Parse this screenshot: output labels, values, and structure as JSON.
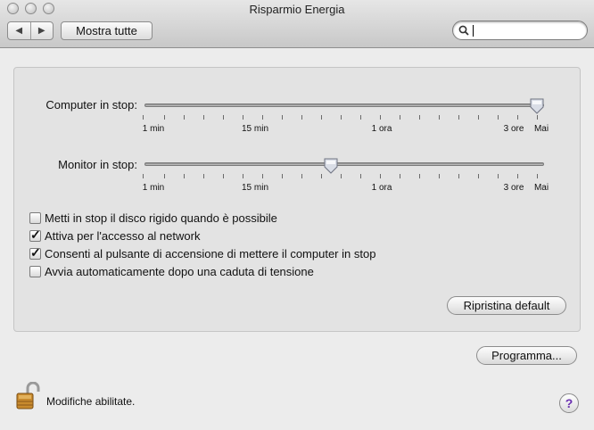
{
  "window": {
    "title": "Risparmio Energia"
  },
  "toolbar": {
    "back_icon": "left-triangle-icon",
    "forward_icon": "right-triangle-icon",
    "show_all_label": "Mostra tutte",
    "search": {
      "value": "",
      "icon": "magnifier-icon"
    }
  },
  "sliders": {
    "computer": {
      "label": "Computer in stop:",
      "ticks": [
        "1 min",
        "15 min",
        "1 ora",
        "3 ore",
        "Mai"
      ],
      "value": "Mai"
    },
    "monitor": {
      "label": "Monitor in stop:",
      "ticks": [
        "1 min",
        "15 min",
        "1 ora",
        "3 ore",
        "Mai"
      ],
      "value": "30 min"
    }
  },
  "options": [
    {
      "label": "Metti in stop il disco rigido quando è possibile",
      "checked": false
    },
    {
      "label": "Attiva per l'accesso al network",
      "checked": true
    },
    {
      "label": "Consenti al pulsante di accensione di mettere il computer in stop",
      "checked": true
    },
    {
      "label": "Avvia automaticamente dopo una caduta di tensione",
      "checked": false
    }
  ],
  "buttons": {
    "restore_default": "Ripristina default",
    "schedule": "Programma..."
  },
  "footer": {
    "lock_label": "Modifiche abilitate.",
    "help_label": "?"
  },
  "colors": {
    "help_accent": "#6a2fb0",
    "panel_bg": "#e3e3e3"
  }
}
